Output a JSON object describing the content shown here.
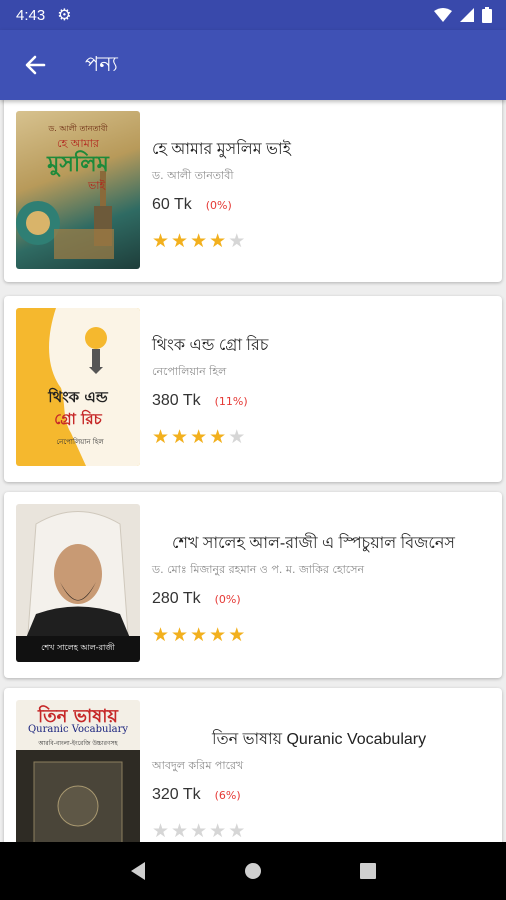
{
  "status": {
    "time": "4:43"
  },
  "header": {
    "title": "পন্য"
  },
  "books": [
    {
      "title": "হে আমার মুসলিম ভাই",
      "author": "ড. আলী তানতাবী",
      "price": "60 Tk",
      "discount": "(0%)",
      "rating": 4,
      "cover": {
        "line1": "ড. আলী তানতাবী",
        "line2": "হে আমার",
        "line3": "মুসলিম",
        "line4": "ভাই"
      }
    },
    {
      "title": "থিংক এন্ড গ্রো রিচ",
      "author": "নেপোলিয়ান হিল",
      "price": "380 Tk",
      "discount": "(11%)",
      "rating": 4,
      "cover": {
        "line1": "থিংক এন্ড",
        "line2": "গ্রো রিচ",
        "line3": "নেপোলিয়ান হিল"
      }
    },
    {
      "title": "শেখ সালেহ আল-রাজী এ স্পিচুয়াল বিজনেস",
      "author": "ড. মোঃ মিজানুর রহমান ও প. ম. জাকির হোসেন",
      "price": "280 Tk",
      "discount": "(0%)",
      "rating": 5,
      "cover": {
        "line1": "শেখ সালেহ আল-রাজী"
      }
    },
    {
      "title": "তিন ভাষায় Quranic Vocabulary",
      "author": "আবদুল করিম পারেখ",
      "price": "320 Tk",
      "discount": "(6%)",
      "rating": 0,
      "cover": {
        "line1": "তিন ভাষায়",
        "line2": "Quranic Vocabulary",
        "line3": "আরবি-বাংলা-ইংরেজি উচ্চারণসহ"
      }
    }
  ],
  "colors": {
    "primary": "#3f51b5",
    "status_bar": "#3949ab",
    "star": "#f2b01e",
    "discount": "#e53935"
  },
  "icons": {
    "back": "arrow-left-icon",
    "settings": "gear-icon",
    "wifi": "wifi-icon",
    "signal": "signal-icon",
    "battery": "battery-icon"
  }
}
